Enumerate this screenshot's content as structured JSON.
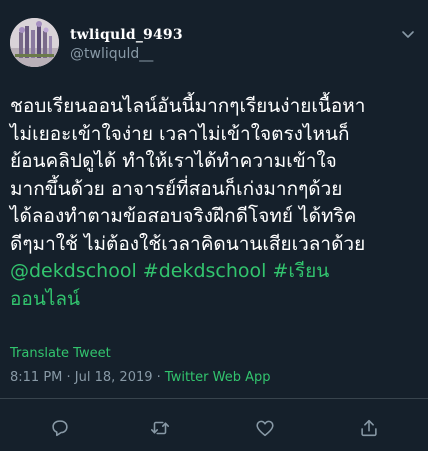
{
  "user": {
    "display_name": "twliquld_9493",
    "handle": "@twliquld__",
    "avatar_icon": "avatar-flowers-icon"
  },
  "tweet": {
    "lines": [
      "ชอบเรียนออนไลน์อันนี้มากๆเรียนง่ายเนื้อหา",
      "ไม่เยอะเข้าใจง่าย เวลาไม่เข้าใจตรงไหนก็",
      "ย้อนคลิปดูได้ ทำให้เราได้ทำความเข้าใจ",
      "มากขึ้นด้วย อาจารย์ที่สอนก็เก่งมากๆด้วย",
      "ได้ลองทำตามข้อสอบจริงฝึกดีโจทย์ ได้ทริค",
      "ดีๆมาใช้ ไม่ต้องใช้เวลาคิดนานเสียเวลาด้วย"
    ],
    "hashtags_line1": "@dekdschool #dekdschool #เรียน",
    "hashtags_line2": "ออนไลน์"
  },
  "translate_label": "Translate Tweet",
  "meta": {
    "time": "8:11 PM",
    "sep1": " · ",
    "date": "Jul 18, 2019",
    "sep2": " · ",
    "source": "Twitter Web App"
  },
  "colors": {
    "background": "#15202b",
    "accent": "#32c46e",
    "muted": "#8899a6",
    "divider": "#38444d"
  },
  "actions": [
    {
      "name": "reply",
      "icon": "reply-icon"
    },
    {
      "name": "retweet",
      "icon": "retweet-icon"
    },
    {
      "name": "like",
      "icon": "heart-icon"
    },
    {
      "name": "share",
      "icon": "share-icon"
    }
  ]
}
